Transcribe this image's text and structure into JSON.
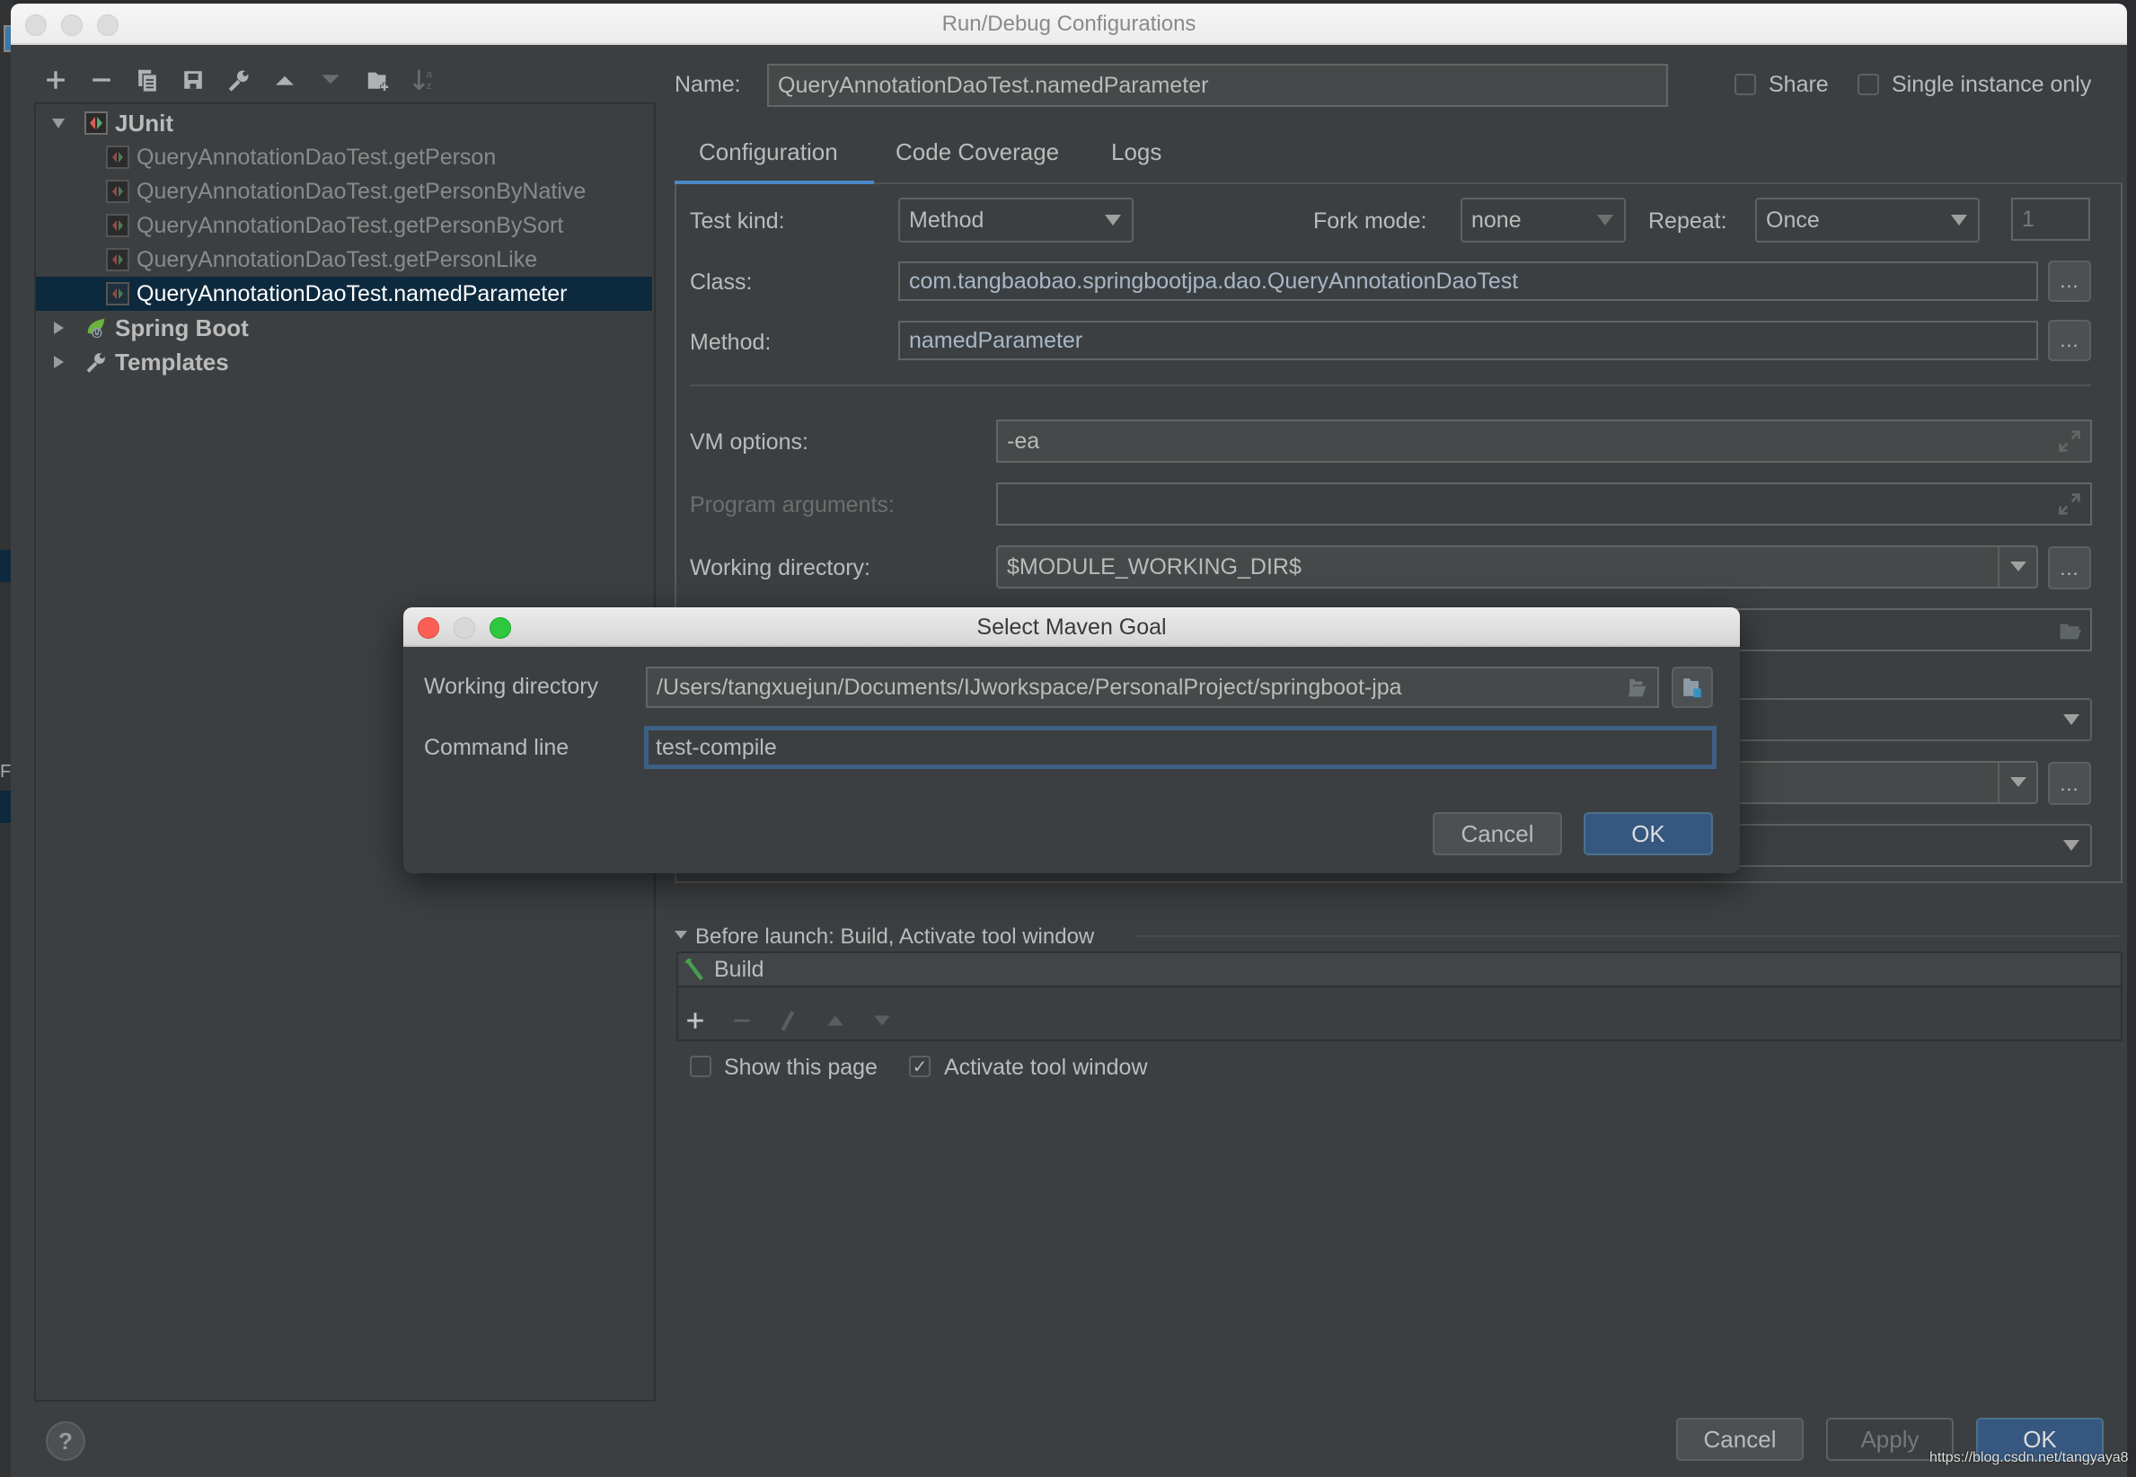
{
  "window": {
    "title": "Run/Debug Configurations"
  },
  "toolbar": {
    "icons": [
      "add-icon",
      "remove-icon",
      "copy-icon",
      "save-icon",
      "wrench-icon",
      "move-up-icon",
      "move-down-icon",
      "new-folder-icon",
      "sort-alpha-icon"
    ]
  },
  "tree": {
    "groups": [
      {
        "label": "JUnit",
        "expanded": true,
        "icon": "junit-icon",
        "children": [
          {
            "label": "QueryAnnotationDaoTest.getPerson",
            "selected": false
          },
          {
            "label": "QueryAnnotationDaoTest.getPersonByNative",
            "selected": false
          },
          {
            "label": "QueryAnnotationDaoTest.getPersonBySort",
            "selected": false
          },
          {
            "label": "QueryAnnotationDaoTest.getPersonLike",
            "selected": false
          },
          {
            "label": "QueryAnnotationDaoTest.namedParameter",
            "selected": true
          }
        ]
      },
      {
        "label": "Spring Boot",
        "expanded": false,
        "icon": "spring-boot-icon"
      },
      {
        "label": "Templates",
        "expanded": false,
        "icon": "wrench-icon"
      }
    ]
  },
  "config": {
    "name_label": "Name:",
    "name_value": "QueryAnnotationDaoTest.namedParameter",
    "share_label": "Share",
    "share_checked": false,
    "single_instance_label": "Single instance only",
    "single_instance_checked": false,
    "tabs": [
      {
        "label": "Configuration",
        "active": true
      },
      {
        "label": "Code Coverage",
        "active": false
      },
      {
        "label": "Logs",
        "active": false
      }
    ],
    "test_kind_label": "Test kind:",
    "test_kind_value": "Method",
    "fork_mode_label": "Fork mode:",
    "fork_mode_value": "none",
    "repeat_label": "Repeat:",
    "repeat_value": "Once",
    "repeat_count": "1",
    "class_label": "Class:",
    "class_value": "com.tangbaobao.springbootjpa.dao.QueryAnnotationDaoTest",
    "method_label": "Method:",
    "method_value": "namedParameter",
    "vm_options_label": "VM options:",
    "vm_options_value": "-ea",
    "program_args_label": "Program arguments:",
    "program_args_value": "",
    "working_dir_label": "Working directory:",
    "working_dir_value": "$MODULE_WORKING_DIR$",
    "browse_label": "..."
  },
  "before_launch": {
    "header": "Before launch: Build, Activate tool window",
    "items": [
      {
        "label": "Build",
        "icon": "hammer-icon"
      }
    ],
    "show_page_label": "Show this page",
    "show_page_checked": false,
    "activate_label": "Activate tool window",
    "activate_checked": true
  },
  "footer": {
    "help_label": "?",
    "cancel_label": "Cancel",
    "apply_label": "Apply",
    "ok_label": "OK"
  },
  "maven_dialog": {
    "title": "Select Maven Goal",
    "working_dir_label": "Working directory",
    "working_dir_value": "/Users/tangxuejun/Documents/IJworkspace/PersonalProject/springboot-jpa",
    "command_line_label": "Command line",
    "command_line_value": "test-compile",
    "cancel_label": "Cancel",
    "ok_label": "OK"
  },
  "watermark": "https://blog.csdn.net/tangyaya8",
  "colors": {
    "background": "#3c3f41",
    "selection": "#0d293e",
    "accent": "#4a88c7",
    "default_button": "#365880"
  }
}
